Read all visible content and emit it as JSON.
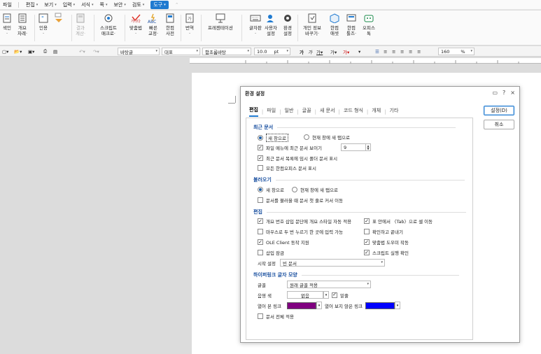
{
  "menu": {
    "file": "파일",
    "items": [
      "편집",
      "보기",
      "입력",
      "서식",
      "쪽",
      "보안",
      "검토"
    ],
    "active": "도구"
  },
  "ribbon": {
    "buttons": [
      {
        "label": "색인\n·"
      },
      {
        "label": "개요\n차례·"
      },
      {
        "label": "인용\n·"
      },
      {
        "label": ""
      },
      {
        "label": "결과\n계산·"
      },
      {
        "label": "스크립트\n매크로·"
      },
      {
        "label": "맞춤법\n·"
      },
      {
        "label": "빠른\n교정·"
      },
      {
        "label": "한컴\n사전"
      },
      {
        "label": "번역\n·"
      },
      {
        "label": "프레젠테이션"
      },
      {
        "label": "글자판\n·"
      },
      {
        "label": "사용자\n설정"
      },
      {
        "label": "환경\n설정"
      },
      {
        "label": "개인 정보\n바꾸기·"
      },
      {
        "label": "한컴\n애셋"
      },
      {
        "label": "한컴\n툴즈·"
      },
      {
        "label": "오피스\n톡"
      }
    ]
  },
  "toolbar": {
    "style": "바탕글",
    "lang": "대표",
    "font": "함초롬바탕",
    "size": "10.0",
    "size_unit": "pt",
    "char_spacing": "160",
    "percent": "%"
  },
  "dialog": {
    "title": "환경 설정",
    "controls": [
      "▭",
      "?",
      "×"
    ],
    "tabs": [
      "편집",
      "파일",
      "일반",
      "글꼴",
      "새 문서",
      "코드 형식",
      "개체",
      "기타"
    ],
    "ok": "설정(D)",
    "cancel": "취소",
    "recent": {
      "title": "최근 문서",
      "radio1": "새 창으로",
      "radio2": "현재 창에 새 탭으로",
      "show_recent": "파일 메뉴에 최근 문서 보이기",
      "count": "9",
      "temp_folder": "최근 문서 목록에 임시 폴더 문서 표시",
      "all_hancom": "모든 한컴오피스 문서 표시"
    },
    "load": {
      "title": "불러오기",
      "radio1": "새 창으로",
      "radio2": "현재 창에 새 탭으로",
      "move_first": "문서를 불러올 때 문서 첫 줄로 커서 이동"
    },
    "edit": {
      "title": "편집",
      "outline": "개요 번호 삽입 문단에 개요 스타일 자동 적용",
      "tab_move": "표 안에서 〈Tab〉으로 셀 이동",
      "dblclick": "마우스로 두 번 누르기 한 곳에 입력 가능",
      "confirm_exit": "확인하고 끝내기",
      "ole": "OLE Client 동작 지원",
      "spell": "맞춤법 도우미 작동",
      "insert_lock": "삽입 잠금",
      "script": "스크립트 실행 확인",
      "start_label": "시작 설정",
      "start_value": "빈 문서"
    },
    "hyperlink": {
      "title": "하이퍼링크 글자 모양",
      "font_label": "글꼴",
      "font_value": "원래 글꼴 적용",
      "shade_label": "음영 색",
      "shade_value": "없음",
      "underline": "밑줄",
      "visited_label": "열어 본 링크",
      "unvisited_label": "열어 보지 않은 링크",
      "visited_color": "#800080",
      "unvisited_color": "#0000ff",
      "apply_all": "문서 전체 적용"
    }
  }
}
